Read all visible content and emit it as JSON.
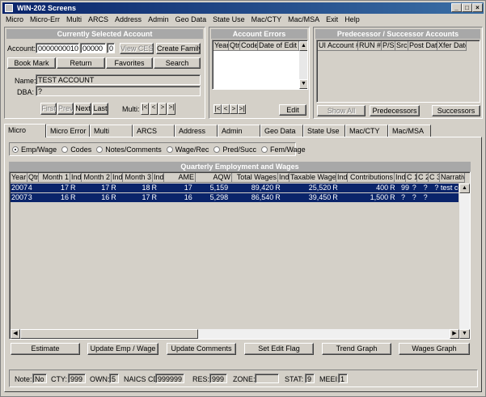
{
  "window": {
    "title": "WIN-202 Screens",
    "min": "_",
    "max": "□",
    "close": "×"
  },
  "menu": [
    "Micro",
    "Micro-Err",
    "Multi",
    "ARCS",
    "Address",
    "Admin",
    "Geo Data",
    "State Use",
    "Mac/CTY",
    "Mac/MSA",
    "Exit",
    "Help"
  ],
  "account_panel": {
    "title": "Currently Selected Account",
    "account_label": "Account:",
    "account_value": "0000000010",
    "sub_value": "00000",
    "sub2_value": "0",
    "view_ces": "View CES",
    "create_family": "Create Family",
    "bookmark": "Book Mark",
    "return": "Return",
    "favorites": "Favorites",
    "search": "Search",
    "name_label": "Name:",
    "name_value": "TEST ACCOUNT",
    "dba_label": "DBA:",
    "dba_value": "?",
    "first": "First",
    "prev": "Prev",
    "next": "Next",
    "last": "Last",
    "multi_label": "Multi:",
    "nav": [
      "|<",
      "<",
      ">",
      ">|"
    ]
  },
  "errors_panel": {
    "title": "Account Errors",
    "columns": [
      "Year",
      "Qtr",
      "Code",
      "Date of Edit"
    ],
    "nav": [
      "|<",
      "<",
      ">",
      ">|"
    ],
    "edit": "Edit"
  },
  "pred_panel": {
    "title": "Predecessor / Successor Accounts",
    "columns": [
      "UI Account #",
      "RUN #",
      "P/S",
      "Src",
      "Post Date",
      "Xfer Date"
    ],
    "show_all": "Show All",
    "predecessors": "Predecessors",
    "successors": "Successors"
  },
  "tabs": [
    "Micro",
    "Micro Error",
    "Multi",
    "ARCS",
    "Address",
    "Admin",
    "Geo Data",
    "State Use",
    "Mac/CTY",
    "Mac/MSA"
  ],
  "radios": [
    "Emp/Wage",
    "Codes",
    "Notes/Comments",
    "Wage/Rec",
    "Pred/Succ",
    "Fem/Wage"
  ],
  "wages": {
    "title": "Quarterly Employment and Wages",
    "columns": [
      "Year",
      "Qtr",
      "Month 1",
      "Ind",
      "Month 2",
      "Ind",
      "Month 3",
      "Ind",
      "AME",
      "AQW",
      "Total Wages",
      "Ind",
      "Taxable Wages",
      "Ind",
      "Contributions",
      "Ind",
      "C 1",
      "C 2",
      "C 3",
      "Narrative"
    ],
    "rows": [
      [
        "2007",
        "4",
        "17",
        "R",
        "17",
        "R",
        "18",
        "R",
        "17",
        "5,159",
        "89,420",
        "R",
        "25,520",
        "R",
        "400",
        "R",
        "99",
        "?",
        "?",
        "? test comm"
      ],
      [
        "2007",
        "3",
        "16",
        "R",
        "16",
        "R",
        "17",
        "R",
        "16",
        "5,298",
        "86,540",
        "R",
        "39,450",
        "R",
        "1,500",
        "R",
        "?",
        "?",
        "?",
        ""
      ]
    ]
  },
  "actions": [
    "Estimate",
    "Update Emp / Wage",
    "Update Comments",
    "Set Edit Flag",
    "Trend Graph",
    "Wages Graph"
  ],
  "status": {
    "note_label": "Note:",
    "note": "No",
    "cty_label": "CTY:",
    "cty": "999",
    "own_label": "OWN:",
    "own": "5",
    "naics_label": "NAICS CD:",
    "naics": "999999",
    "res_label": "RES:",
    "res": "999",
    "zone_label": "ZONE:",
    "zone": "",
    "stat_label": "STAT:",
    "stat": "9",
    "meei_label": "MEEI:",
    "meei": "1"
  }
}
